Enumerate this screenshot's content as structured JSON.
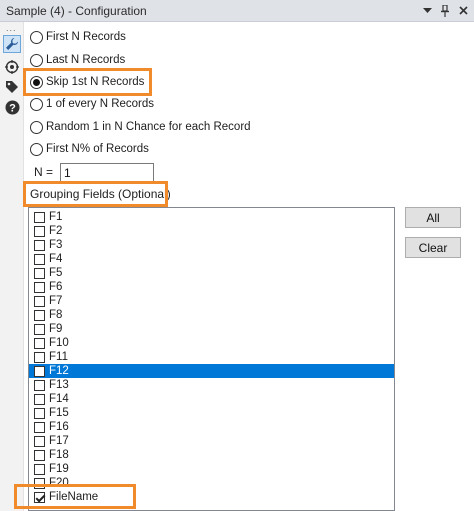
{
  "window": {
    "title": "Sample (4) - Configuration"
  },
  "options": [
    {
      "label": "First N Records",
      "checked": false
    },
    {
      "label": "Last N Records",
      "checked": false
    },
    {
      "label": "Skip 1st N Records",
      "checked": true
    },
    {
      "label": "1 of every N Records",
      "checked": false
    },
    {
      "label": "Random 1 in N Chance for each Record",
      "checked": false
    },
    {
      "label": "First N% of Records",
      "checked": false
    }
  ],
  "n_field": {
    "label": "N =",
    "value": "1"
  },
  "grouping": {
    "label": "Grouping Fields (Optional)",
    "fields": [
      {
        "label": "F1",
        "checked": false
      },
      {
        "label": "F2",
        "checked": false
      },
      {
        "label": "F3",
        "checked": false
      },
      {
        "label": "F4",
        "checked": false
      },
      {
        "label": "F5",
        "checked": false
      },
      {
        "label": "F6",
        "checked": false
      },
      {
        "label": "F7",
        "checked": false
      },
      {
        "label": "F8",
        "checked": false
      },
      {
        "label": "F9",
        "checked": false
      },
      {
        "label": "F10",
        "checked": false
      },
      {
        "label": "F11",
        "checked": false
      },
      {
        "label": "F12",
        "checked": false,
        "selected": true
      },
      {
        "label": "F13",
        "checked": false
      },
      {
        "label": "F14",
        "checked": false
      },
      {
        "label": "F15",
        "checked": false
      },
      {
        "label": "F16",
        "checked": false
      },
      {
        "label": "F17",
        "checked": false
      },
      {
        "label": "F18",
        "checked": false
      },
      {
        "label": "F19",
        "checked": false
      },
      {
        "label": "F20",
        "checked": false
      },
      {
        "label": "FileName",
        "checked": true
      }
    ]
  },
  "buttons": {
    "all": "All",
    "clear": "Clear"
  },
  "sidebar": {
    "dots": "..."
  },
  "colors": {
    "highlight": "#f08a2b",
    "selection": "#0078d7"
  }
}
